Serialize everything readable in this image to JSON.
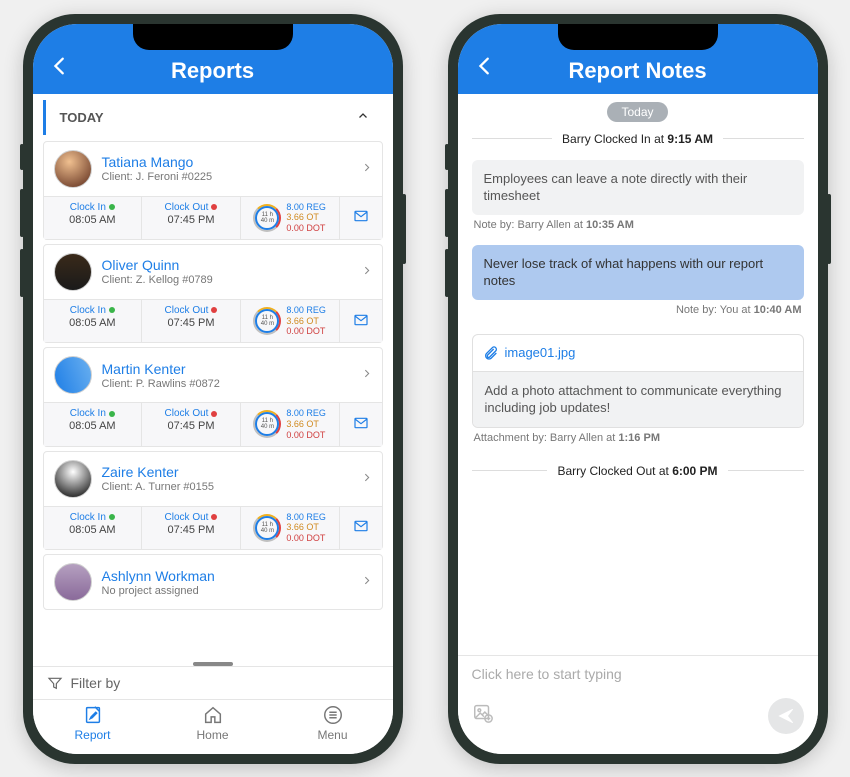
{
  "left": {
    "header_title": "Reports",
    "section_label": "TODAY",
    "filter_label": "Filter by",
    "tabs": {
      "report": "Report",
      "home": "Home",
      "menu": "Menu"
    },
    "common": {
      "clock_in_label": "Clock In",
      "clock_out_label": "Clock Out",
      "clock_hours": "11",
      "clock_h_unit": "h",
      "clock_mins": "40",
      "clock_m_unit": "m",
      "reg": "8.00 REG",
      "ot": "3.66 OT",
      "dot": "0.00 DOT"
    },
    "employees": [
      {
        "name": "Tatiana Mango",
        "client": "Client: J. Feroni #0225",
        "clock_in": "08:05 AM",
        "clock_out": "07:45 PM",
        "avatar": "av1"
      },
      {
        "name": "Oliver Quinn",
        "client": "Client: Z. Kellog #0789",
        "clock_in": "08:05 AM",
        "clock_out": "07:45 PM",
        "avatar": "av2"
      },
      {
        "name": "Martin Kenter",
        "client": "Client: P. Rawlins #0872",
        "clock_in": "08:05 AM",
        "clock_out": "07:45 PM",
        "avatar": "av3"
      },
      {
        "name": "Zaire Kenter",
        "client": "Client: A. Turner #0155",
        "clock_in": "08:05 AM",
        "clock_out": "07:45 PM",
        "avatar": "av4"
      },
      {
        "name": "Ashlynn Workman",
        "client": "No project assigned",
        "clock_in": "",
        "clock_out": "",
        "avatar": "av5"
      }
    ]
  },
  "right": {
    "header_title": "Report Notes",
    "pill": "Today",
    "clock_in_event_pre": "Barry Clocked In at ",
    "clock_in_event_time": "9:15 AM",
    "note1": "Employees can leave a note directly with their timesheet",
    "note1_meta_pre": "Note by: Barry Allen at ",
    "note1_meta_time": "10:35 AM",
    "note2": "Never lose track of what happens with our report notes",
    "note2_meta_pre": "Note by: You at ",
    "note2_meta_time": "10:40 AM",
    "attach_file": "image01.jpg",
    "attach_body": "Add a photo attachment to communicate everything including job updates!",
    "attach_meta_pre": "Attachment by: Barry Allen at ",
    "attach_meta_time": "1:16 PM",
    "clock_out_event_pre": "Barry Clocked Out at ",
    "clock_out_event_time": "6:00 PM",
    "composer_placeholder": "Click here to start typing"
  },
  "colors": {
    "primary": "#1e7ee6"
  }
}
